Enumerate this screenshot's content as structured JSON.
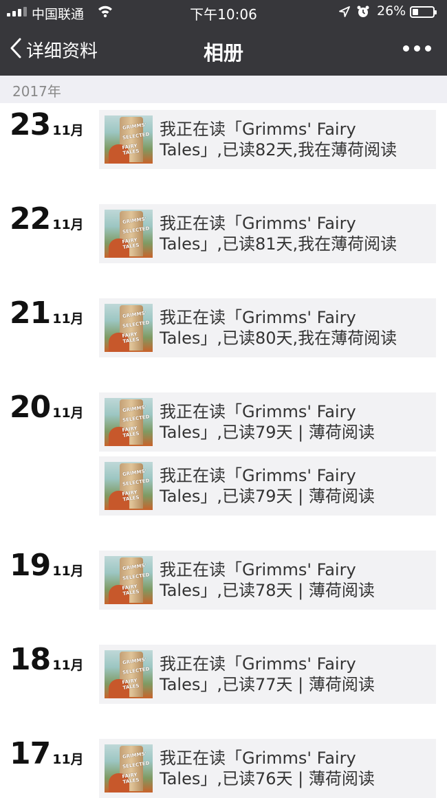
{
  "status_bar": {
    "carrier": "中国联通",
    "time": "下午10:06",
    "battery": "26%",
    "battery_level": 0.26
  },
  "nav": {
    "back_label": "详细资料",
    "title": "相册"
  },
  "year": "2017年",
  "cover": {
    "line1": "GRIMMS'",
    "line2": "SELECTED",
    "line3": "FAIRY TALES"
  },
  "groups": [
    {
      "day": "23",
      "month": "11月",
      "posts": [
        {
          "line1": "我正在读「Grimms' Fairy",
          "line2": "Tales」,已读82天,我在薄荷阅读"
        }
      ]
    },
    {
      "day": "22",
      "month": "11月",
      "posts": [
        {
          "line1": "我正在读「Grimms' Fairy",
          "line2": "Tales」,已读81天,我在薄荷阅读"
        }
      ]
    },
    {
      "day": "21",
      "month": "11月",
      "posts": [
        {
          "line1": "我正在读「Grimms' Fairy",
          "line2": "Tales」,已读80天,我在薄荷阅读"
        }
      ]
    },
    {
      "day": "20",
      "month": "11月",
      "posts": [
        {
          "line1": "我正在读「Grimms' Fairy",
          "line2": "Tales」,已读79天 | 薄荷阅读"
        },
        {
          "line1": "我正在读「Grimms' Fairy",
          "line2": "Tales」,已读79天 | 薄荷阅读"
        }
      ]
    },
    {
      "day": "19",
      "month": "11月",
      "posts": [
        {
          "line1": "我正在读「Grimms' Fairy",
          "line2": "Tales」,已读78天 | 薄荷阅读"
        }
      ]
    },
    {
      "day": "18",
      "month": "11月",
      "posts": [
        {
          "line1": "我正在读「Grimms' Fairy",
          "line2": "Tales」,已读77天 | 薄荷阅读"
        }
      ]
    },
    {
      "day": "17",
      "month": "11月",
      "posts": [
        {
          "line1": "我正在读「Grimms' Fairy",
          "line2": "Tales」,已读76天 | 薄荷阅读"
        }
      ]
    }
  ]
}
